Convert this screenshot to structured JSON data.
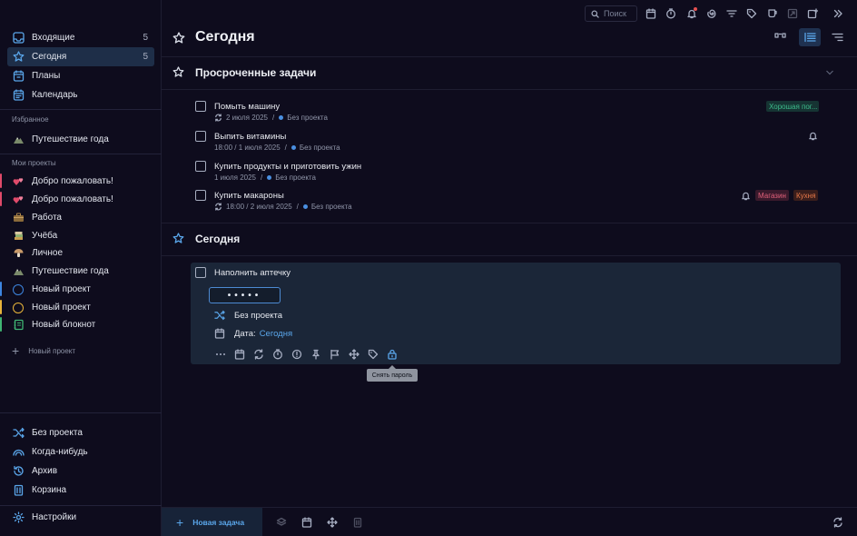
{
  "sidebar": {
    "nav": [
      {
        "label": "Входящие",
        "count": "5",
        "icon": "inbox-icon"
      },
      {
        "label": "Сегодня",
        "count": "5",
        "icon": "star-icon"
      },
      {
        "label": "Планы",
        "count": "",
        "icon": "calendar-plans-icon"
      },
      {
        "label": "Календарь",
        "count": "",
        "icon": "calendar-icon"
      }
    ],
    "favorites_label": "Избранное",
    "favorites": [
      {
        "label": "Путешествие года",
        "icon": "mountain-icon"
      }
    ],
    "projects_label": "Мои проекты",
    "projects": [
      {
        "label": "Добро пожаловать!",
        "icon": "hearts-icon",
        "color": "#e04a6a"
      },
      {
        "label": "Добро пожаловать!",
        "icon": "hearts-icon",
        "color": "#e04a6a"
      },
      {
        "label": "Работа",
        "icon": "briefcase-icon",
        "color": ""
      },
      {
        "label": "Учёба",
        "icon": "books-icon",
        "color": ""
      },
      {
        "label": "Личное",
        "icon": "mushroom-icon",
        "color": ""
      },
      {
        "label": "Путешествие года",
        "icon": "mountain-icon",
        "color": ""
      },
      {
        "label": "Новый проект",
        "icon": "circle-icon",
        "color": "#3d86e0"
      },
      {
        "label": "Новый проект",
        "icon": "circle-icon",
        "color": "#e8b43a"
      },
      {
        "label": "Новый блокнот",
        "icon": "notebook-icon",
        "color": "#3fb573"
      }
    ],
    "new_project_label": "Новый проект",
    "bottom": [
      {
        "label": "Без проекта",
        "icon": "shuffle-icon"
      },
      {
        "label": "Когда-нибудь",
        "icon": "rainbow-icon"
      },
      {
        "label": "Архив",
        "icon": "history-icon"
      },
      {
        "label": "Корзина",
        "icon": "trash-icon"
      }
    ],
    "settings_label": "Настройки"
  },
  "toolbar": {
    "search_placeholder": "Поиск"
  },
  "main": {
    "title": "Сегодня",
    "overdue": {
      "title": "Просроченные задачи",
      "tasks": [
        {
          "title": "Помыть машину",
          "date": "2 июля 2025",
          "project": "Без проекта",
          "tags": [
            "Хорошая пог..."
          ]
        },
        {
          "title": "Выпить витамины",
          "date": "18:00 / 1 июля 2025",
          "project": "Без проекта",
          "tags": []
        },
        {
          "title": "Купить продукты и приготовить ужин",
          "date": "1 июля 2025",
          "project": "Без проекта",
          "tags": []
        },
        {
          "title": "Купить макароны",
          "date": "18:00 / 2 июля 2025",
          "project": "Без проекта",
          "tags": [
            "Магазин",
            "Кухня"
          ]
        }
      ]
    },
    "today": {
      "title": "Сегодня",
      "task": {
        "title": "Наполнить аптечку",
        "password_mask": "•••••",
        "project": "Без проекта",
        "date_label": "Дата:",
        "date_value": "Сегодня",
        "tooltip": "Снять пароль"
      }
    }
  },
  "bottom_bar": {
    "new_task_label": "Новая задача"
  },
  "colors": {
    "accent": "#5aa6ea",
    "background": "#0e0c1d",
    "tag_green": "#3dbd8c",
    "tag_red": "#e0607a",
    "tag_orange": "#ea7a4a"
  }
}
